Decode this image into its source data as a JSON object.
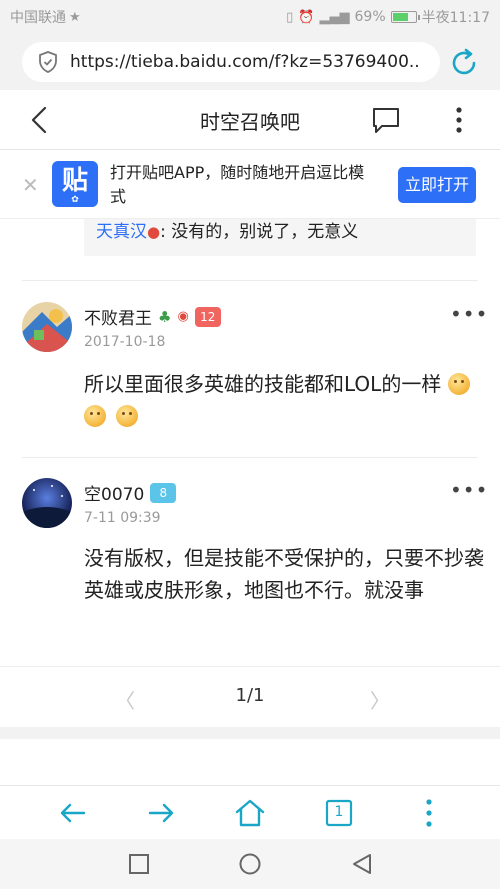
{
  "status_bar": {
    "carrier": "中国联通",
    "battery": "69%",
    "time": "半夜11:17",
    "battery_level": 0.69
  },
  "browser": {
    "url": "https://tieba.baidu.com/f?kz=53769400..."
  },
  "header": {
    "title": "时空召唤吧"
  },
  "banner": {
    "logo_text": "贴",
    "text": "打开贴吧APP，随时随地开启逗比模式",
    "open_button": "立即打开"
  },
  "quote": {
    "name": "天真汉",
    "text": ": 没有的，别说了，无意义"
  },
  "posts": [
    {
      "username": "不败君王",
      "level": "12",
      "date": "2017-10-18",
      "body": "所以里面很多英雄的技能都和LOL的一样",
      "level_color": "#f0655f"
    },
    {
      "username": "空0070",
      "level": "8",
      "date": "7-11 09:39",
      "body": "没有版权，但是技能不受保护的，只要不抄袭英雄或皮肤形象，地图也不行。就没事",
      "level_color": "#5bc4e8"
    }
  ],
  "pagination": {
    "page": "1/1"
  },
  "toolbar": {
    "tab_count": "1",
    "accent_color": "#1aa6c7"
  }
}
